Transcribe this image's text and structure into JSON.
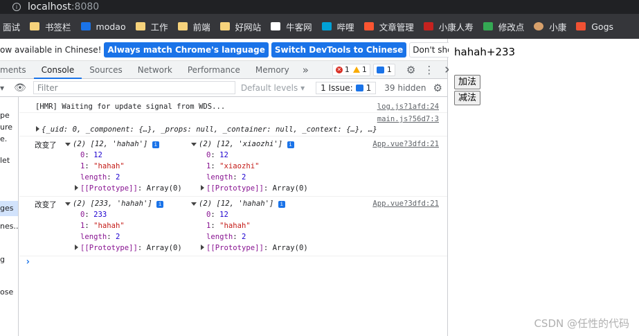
{
  "address": {
    "host": "localhost",
    "port": ":8080"
  },
  "bookmarks": [
    {
      "label": "面试",
      "icon": "bookmark-icon"
    },
    {
      "label": "书签栏",
      "icon": "folder-icon"
    },
    {
      "label": "modao",
      "icon": "modao-icon"
    },
    {
      "label": "工作",
      "icon": "folder-icon"
    },
    {
      "label": "前端",
      "icon": "folder-icon"
    },
    {
      "label": "好网站",
      "icon": "folder-icon"
    },
    {
      "label": "牛客网",
      "icon": "nowcoder-icon"
    },
    {
      "label": "哔哩",
      "icon": "bilibili-icon"
    },
    {
      "label": "文章管理",
      "icon": "csdn-icon"
    },
    {
      "label": "小康人寿",
      "icon": "gmail-icon"
    },
    {
      "label": "修改点",
      "icon": "leaf-icon"
    },
    {
      "label": "小康",
      "icon": "avatar-icon"
    },
    {
      "label": "Gogs",
      "icon": "gogs-icon"
    }
  ],
  "banner": {
    "text": "ow available in Chinese!",
    "match_button": "Always match Chrome's language",
    "switch_button": "Switch DevTools to Chinese",
    "dismiss_button": "Don't show again",
    "close": "✕"
  },
  "tabs": [
    {
      "label": "ments",
      "active": false
    },
    {
      "label": "Console",
      "active": true
    },
    {
      "label": "Sources",
      "active": false
    },
    {
      "label": "Network",
      "active": false
    },
    {
      "label": "Performance",
      "active": false
    },
    {
      "label": "Memory",
      "active": false
    }
  ],
  "tab_more": "»",
  "badges": {
    "errors": "1",
    "warnings": "1",
    "messages": "1"
  },
  "toolbar": {
    "filter_placeholder": "Filter",
    "levels": "Default levels ▾",
    "issues": "1 Issue:",
    "issues_count": "1",
    "hidden": "39 hidden"
  },
  "sidebar": [
    {
      "text": "pe"
    },
    {
      "text": "ure"
    },
    {
      "text": "e."
    },
    {
      "text": "let"
    },
    {
      "text": "ges"
    },
    {
      "text": "nes..."
    },
    {
      "text": "g"
    },
    {
      "text": "ose"
    }
  ],
  "console": {
    "hmr": "[HMR] Waiting for update signal from WDS...",
    "hmr_src": "log.js?1afd:24",
    "main_src": "main.js?56d7:3",
    "obj_line": "{_uid: 0, _component: {…}, _props: null, _container: null, _context: {…}, …}",
    "log1": {
      "prefix": "改变了",
      "src": "App.vue?3dfd:21",
      "a_head": "(2) [12, 'hahah']",
      "a_items": [
        {
          "k": "0",
          "v": "12",
          "t": "num"
        },
        {
          "k": "1",
          "v": "\"hahah\"",
          "t": "str"
        }
      ],
      "b_head": "(2) [12, 'xiaozhi']",
      "b_items": [
        {
          "k": "0",
          "v": "12",
          "t": "num"
        },
        {
          "k": "1",
          "v": "\"xiaozhi\"",
          "t": "str"
        }
      ],
      "length": "2",
      "proto": "[[Prototype]]",
      "proto_val": ": Array(0)"
    },
    "log2": {
      "prefix": "改变了",
      "src": "App.vue?3dfd:21",
      "a_head": "(2) [233, 'hahah']",
      "a_items": [
        {
          "k": "0",
          "v": "233",
          "t": "num"
        },
        {
          "k": "1",
          "v": "\"hahah\"",
          "t": "str"
        }
      ],
      "b_head": "(2) [12, 'hahah']",
      "b_items": [
        {
          "k": "0",
          "v": "12",
          "t": "num"
        },
        {
          "k": "1",
          "v": "\"hahah\"",
          "t": "str"
        }
      ],
      "length": "2",
      "proto": "[[Prototype]]",
      "proto_val": ": Array(0)"
    },
    "prompt": "›"
  },
  "page": {
    "display": "hahah+233",
    "add_button": "加法",
    "sub_button": "减法"
  },
  "watermark": "CSDN @任性的代码"
}
